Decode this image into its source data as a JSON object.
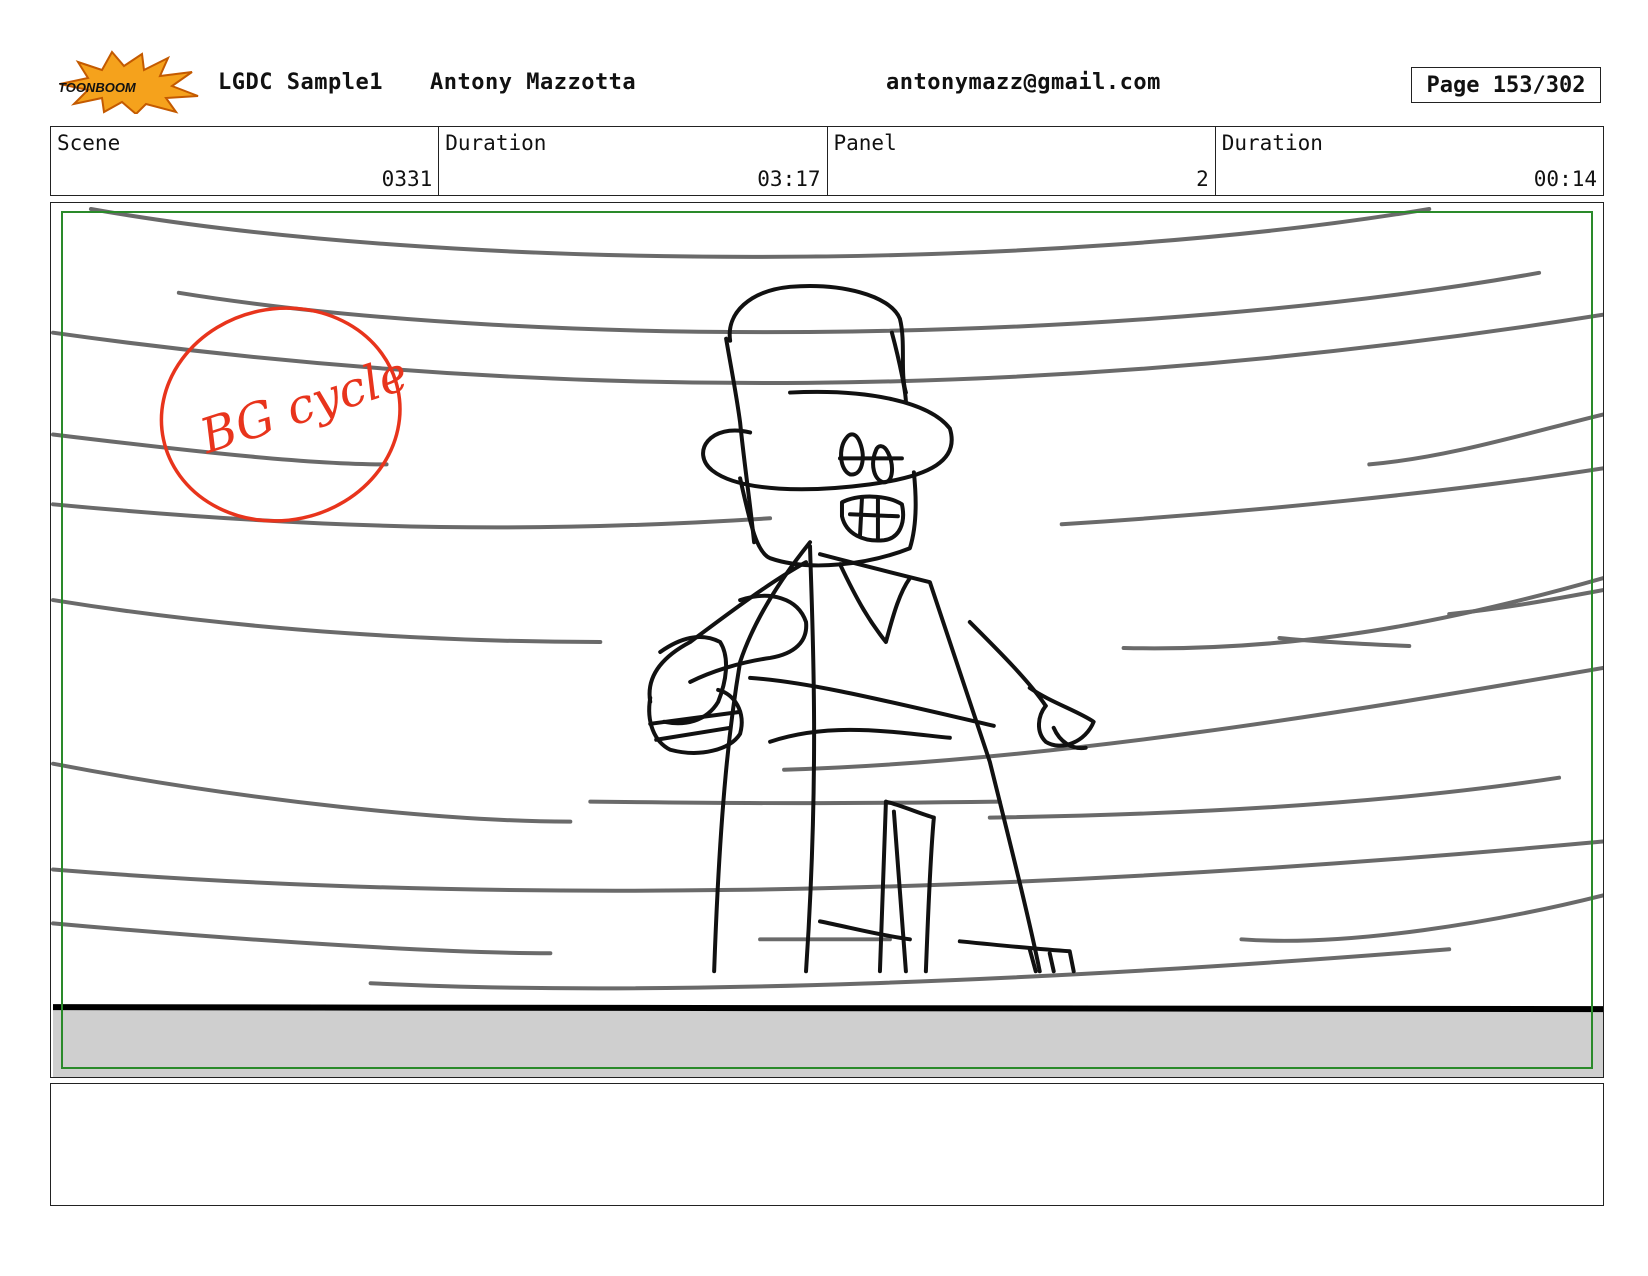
{
  "header": {
    "logo_text": "TOONBOOM",
    "project": "LGDC Sample1",
    "author": "Antony Mazzotta",
    "email": "antonymazz@gmail.com",
    "page": "Page 153/302"
  },
  "info": {
    "scene_label": "Scene",
    "scene_value": "0331",
    "duration_label": "Duration",
    "duration_value": "03:17",
    "panel_label": "Panel",
    "panel_value": "2",
    "panel_duration_label": "Duration",
    "panel_duration_value": "00:14"
  },
  "panel": {
    "annotation": "BG cycle"
  },
  "notes": {
    "text": ""
  }
}
